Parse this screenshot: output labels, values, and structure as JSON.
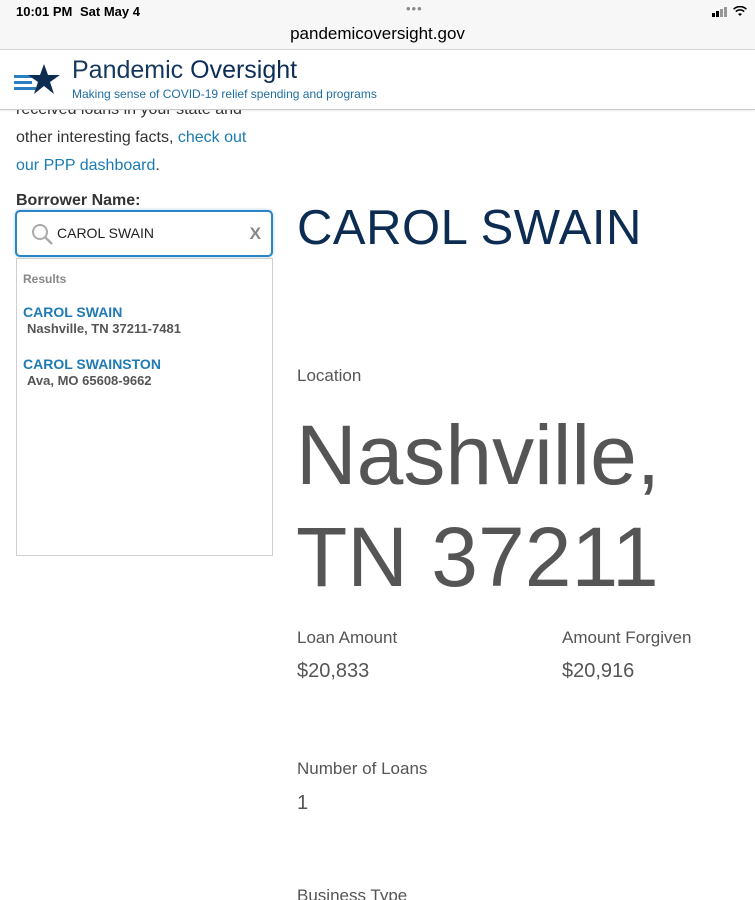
{
  "status_bar": {
    "time": "10:01 PM",
    "date": "Sat May 4",
    "dots": "•••"
  },
  "browser": {
    "url": "pandemicoversight.gov"
  },
  "header": {
    "title_light": "Pandemic",
    "title_bold": "Oversight",
    "tagline": "Making sense of COVID-19 relief spending and programs",
    "logo_icon": "star-stripes-logo"
  },
  "intro": {
    "line_partial": "received loans in your state and",
    "text": "other interesting facts, ",
    "link": "check out our PPP dashboard",
    "trailing": "."
  },
  "search": {
    "label": "Borrower Name:",
    "value": "CAROL SWAIN",
    "clear": "X",
    "results_heading": "Results",
    "results": [
      {
        "name": "CAROL SWAIN",
        "address": "Nashville, TN 37211-7481"
      },
      {
        "name": "CAROL SWAINSTON",
        "address": "Ava, MO 65608-9662"
      }
    ]
  },
  "detail": {
    "borrower": "CAROL SWAIN",
    "location_label": "Location",
    "location_value": "Nashville, TN 37211",
    "loan_amount_label": "Loan Amount",
    "loan_amount": "$20,833",
    "forgiven_label": "Amount Forgiven",
    "forgiven": "$20,916",
    "num_loans_label": "Number of Loans",
    "num_loans": "1",
    "business_type_label": "Business Type"
  },
  "colors": {
    "navy": "#0c2c52",
    "link": "#1b7bb5",
    "focus": "#2a84c5"
  }
}
